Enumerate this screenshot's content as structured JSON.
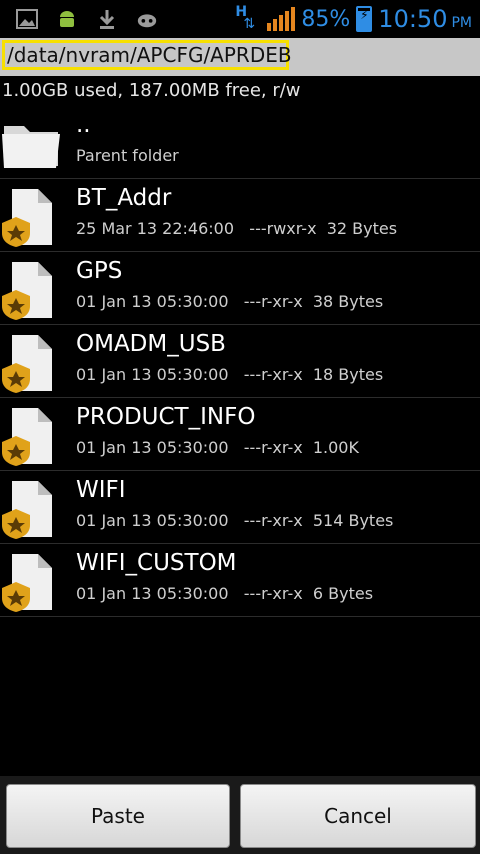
{
  "status_bar": {
    "network_type": "H",
    "battery_percent": "85%",
    "time": "10:50",
    "ampm": "PM",
    "icons": [
      "image-icon",
      "android-icon",
      "download-icon",
      "android-cat-icon",
      "signal-icon",
      "battery-icon"
    ]
  },
  "path": "/data/nvram/APCFG/APRDEB",
  "storage_info": "1.00GB used, 187.00MB free, r/w",
  "parent": {
    "name": "..",
    "label": "Parent folder"
  },
  "files": [
    {
      "name": "BT_Addr",
      "date": "25 Mar 13 22:46:00",
      "perms": "---rwxr-x",
      "size": "32 Bytes"
    },
    {
      "name": "GPS",
      "date": "01 Jan 13 05:30:00",
      "perms": "---r-xr-x",
      "size": "38 Bytes"
    },
    {
      "name": "OMADM_USB",
      "date": "01 Jan 13 05:30:00",
      "perms": "---r-xr-x",
      "size": "18 Bytes"
    },
    {
      "name": "PRODUCT_INFO",
      "date": "01 Jan 13 05:30:00",
      "perms": "---r-xr-x",
      "size": "1.00K"
    },
    {
      "name": "WIFI",
      "date": "01 Jan 13 05:30:00",
      "perms": "---r-xr-x",
      "size": "514 Bytes"
    },
    {
      "name": "WIFI_CUSTOM",
      "date": "01 Jan 13 05:30:00",
      "perms": "---r-xr-x",
      "size": "6 Bytes"
    }
  ],
  "buttons": {
    "paste": "Paste",
    "cancel": "Cancel"
  },
  "colors": {
    "accent": "#2f8de4",
    "signal": "#e5861f",
    "path_border": "#f7e000"
  }
}
